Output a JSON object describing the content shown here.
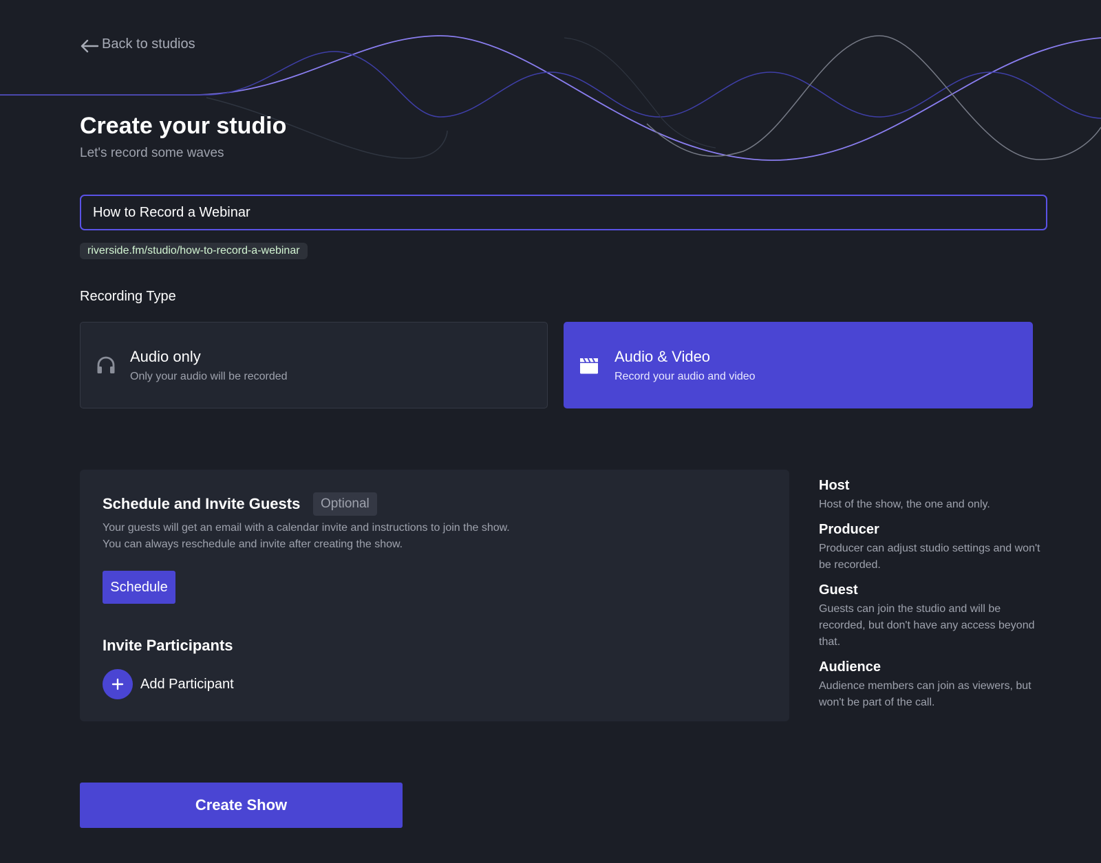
{
  "nav": {
    "back_label": "Back to studios"
  },
  "header": {
    "title": "Create your studio",
    "subtitle": "Let's record some waves"
  },
  "studio": {
    "name_value": "How to Record a Webinar",
    "url": "riverside.fm/studio/how-to-record-a-webinar"
  },
  "recording_type": {
    "label": "Recording Type",
    "options": [
      {
        "title": "Audio only",
        "description": "Only your audio will be recorded",
        "icon": "headphones-icon",
        "selected": false
      },
      {
        "title": "Audio & Video",
        "description": "Record your audio and video",
        "icon": "clapperboard-icon",
        "selected": true
      }
    ]
  },
  "schedule": {
    "heading": "Schedule and Invite Guests",
    "badge": "Optional",
    "description_line1": "Your guests will get an email with a calendar invite and instructions to join the show.",
    "description_line2": "You can always reschedule and invite after creating the show.",
    "schedule_button": "Schedule",
    "invite_heading": "Invite Participants",
    "add_participant_label": "Add Participant"
  },
  "roles": [
    {
      "name": "Host",
      "description": "Host of the show, the one and only."
    },
    {
      "name": "Producer",
      "description": "Producer can adjust studio settings and won't be recorded."
    },
    {
      "name": "Guest",
      "description": "Guests can join the studio and will be recorded, but don't have any access beyond that."
    },
    {
      "name": "Audience",
      "description": "Audience members can join as viewers, but won't be part of the call."
    }
  ],
  "actions": {
    "create_label": "Create Show"
  },
  "colors": {
    "background": "#1b1e26",
    "accent": "#4a45d3",
    "input_border": "#5a52e6",
    "url_text": "#d2f4d2",
    "muted_text": "#9ea2ad"
  }
}
